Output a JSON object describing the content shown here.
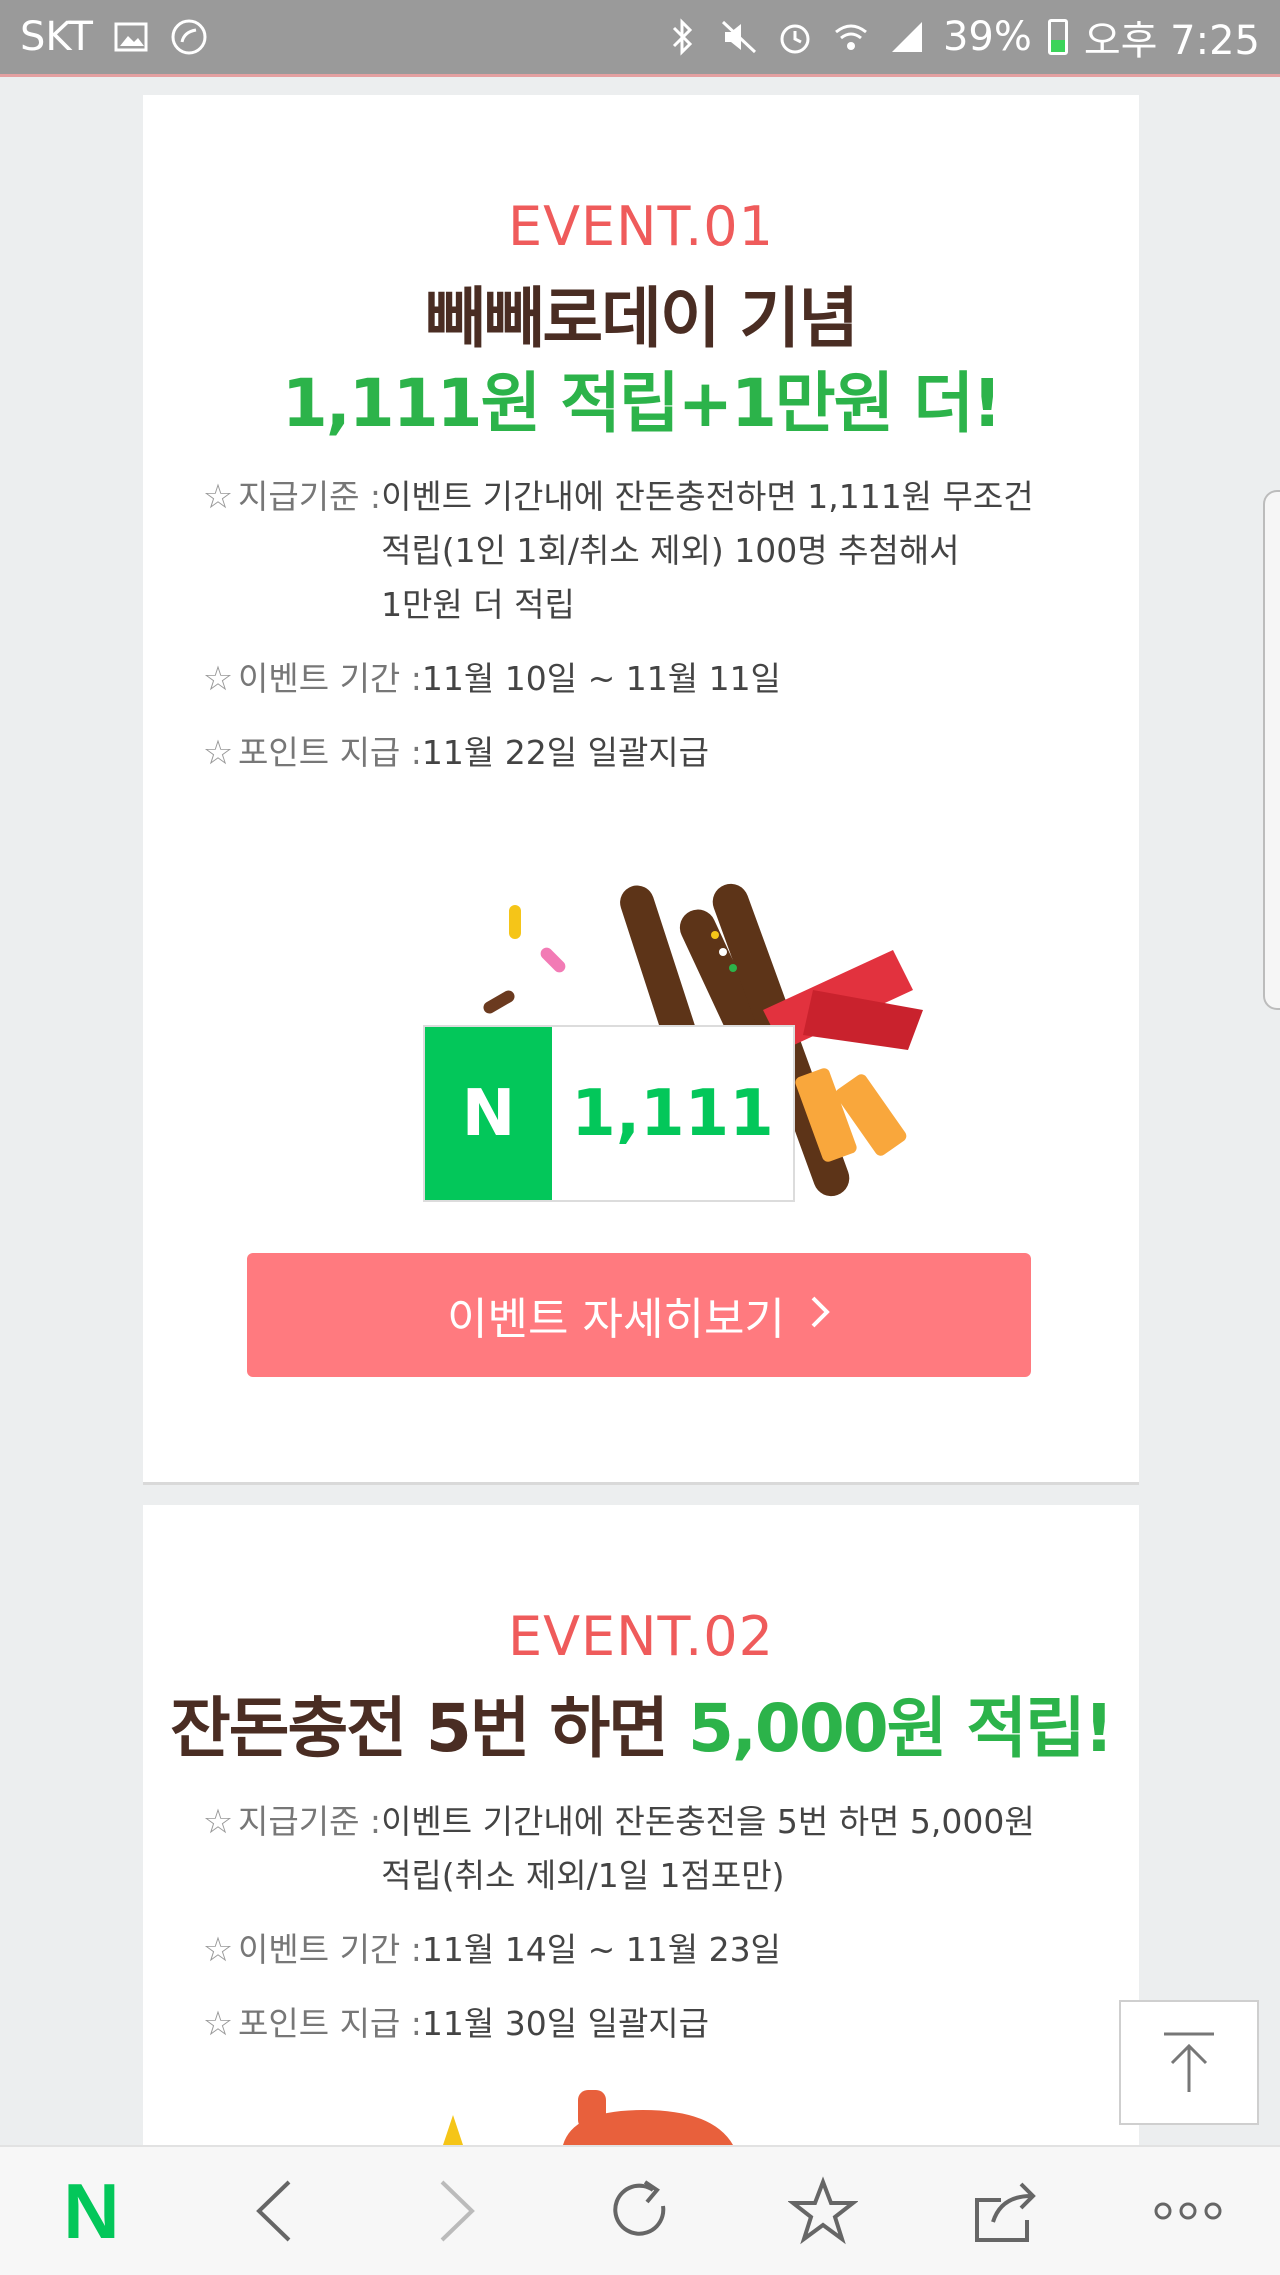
{
  "status": {
    "carrier": "SKT",
    "battery": "39%",
    "time": "오후 7:25",
    "battery_color": "#3bd45a"
  },
  "event1": {
    "label": "EVENT.01",
    "title_line1": "빼빼로데이 기념",
    "title_line2": "1,111원 적립+1만원 더!",
    "rows": [
      {
        "label": "지급기준 : ",
        "lines": [
          "이벤트 기간내에 잔돈충전하면 1,111원 무조건",
          "적립(1인 1회/취소 제외) 100명 추첨해서",
          "1만원 더 적립"
        ]
      },
      {
        "label": "이벤트 기간 : ",
        "lines": [
          "11월 10일 ~ 11월 11일"
        ]
      },
      {
        "label": "포인트 지급 : ",
        "lines": [
          "11월 22일 일괄지급"
        ]
      }
    ],
    "badge_symbol": "N",
    "badge_value": "1,111",
    "button_label": "이벤트 자세히보기"
  },
  "event2": {
    "label": "EVENT.02",
    "title_part1": "잔돈충전 5번 하면 ",
    "title_part2": "5,000원 적립!",
    "rows": [
      {
        "label": "지급기준 : ",
        "lines": [
          "이벤트 기간내에 잔돈충전을 5번 하면 5,000원",
          "적립(취소 제외/1일 1점포만)"
        ]
      },
      {
        "label": "이벤트 기간 : ",
        "lines": [
          "11월 14일 ~ 11월 23일"
        ]
      },
      {
        "label": "포인트 지급 : ",
        "lines": [
          "11월 30일 일괄지급"
        ]
      }
    ]
  },
  "bottombar": {
    "logo": "N",
    "icons": [
      "back-icon",
      "forward-icon",
      "refresh-icon",
      "bookmark-star-icon",
      "share-icon",
      "more-icon"
    ]
  },
  "colors": {
    "accent_red": "#ef5b5b",
    "accent_green": "#2cb34a",
    "naver_green": "#03c75a",
    "button_pink": "#ff7a7f"
  }
}
